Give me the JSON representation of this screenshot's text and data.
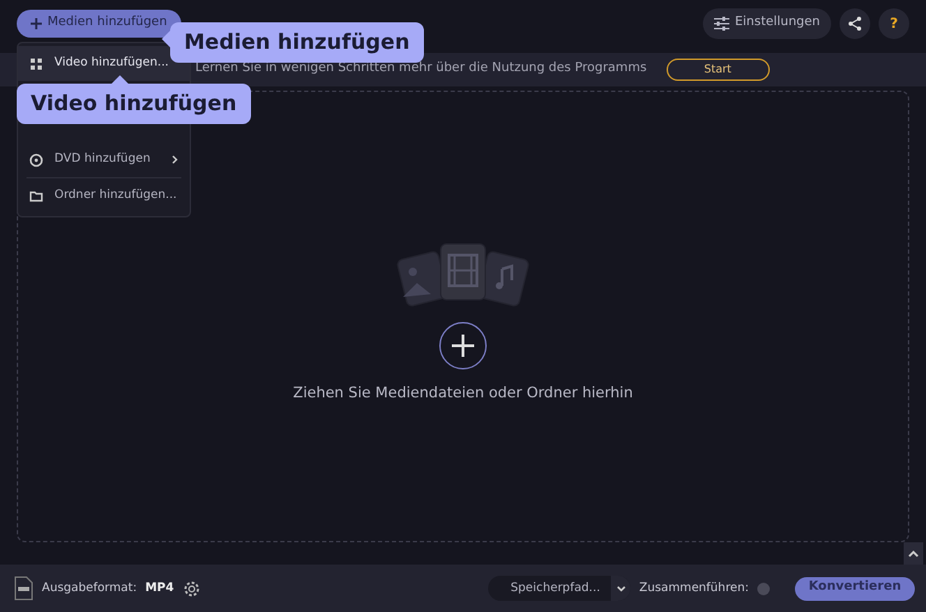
{
  "toolbar": {
    "add_media_button": "Medien hinzufügen",
    "settings_button": "Einstellungen",
    "help_button": "?"
  },
  "banner": {
    "text": "Lernen Sie in wenigen Schritten mehr über die Nutzung des Programms",
    "start_button": "Start"
  },
  "add_menu": {
    "items": [
      {
        "label": "Video hinzufügen...",
        "kind": "video",
        "has_submenu": false,
        "selected": true
      },
      {
        "label": "DVD hinzufügen",
        "kind": "dvd",
        "has_submenu": true,
        "selected": false
      },
      {
        "label": "Ordner hinzufügen...",
        "kind": "folder",
        "has_submenu": false,
        "selected": false
      }
    ]
  },
  "tooltips": [
    {
      "text": "Medien hinzufügen",
      "kind": "button"
    },
    {
      "text": "Video hinzufügen",
      "kind": "menu"
    }
  ],
  "drop_zone": {
    "hint": "Ziehen Sie Mediendateien oder Ordner hierhin"
  },
  "bottom_bar": {
    "format_label": "Ausgabeformat:",
    "format_value": "MP4",
    "save_path": "Speicherpfad...",
    "merge_label": "Zusammenführen:",
    "merge_on": false,
    "convert_button": "Konvertieren"
  }
}
